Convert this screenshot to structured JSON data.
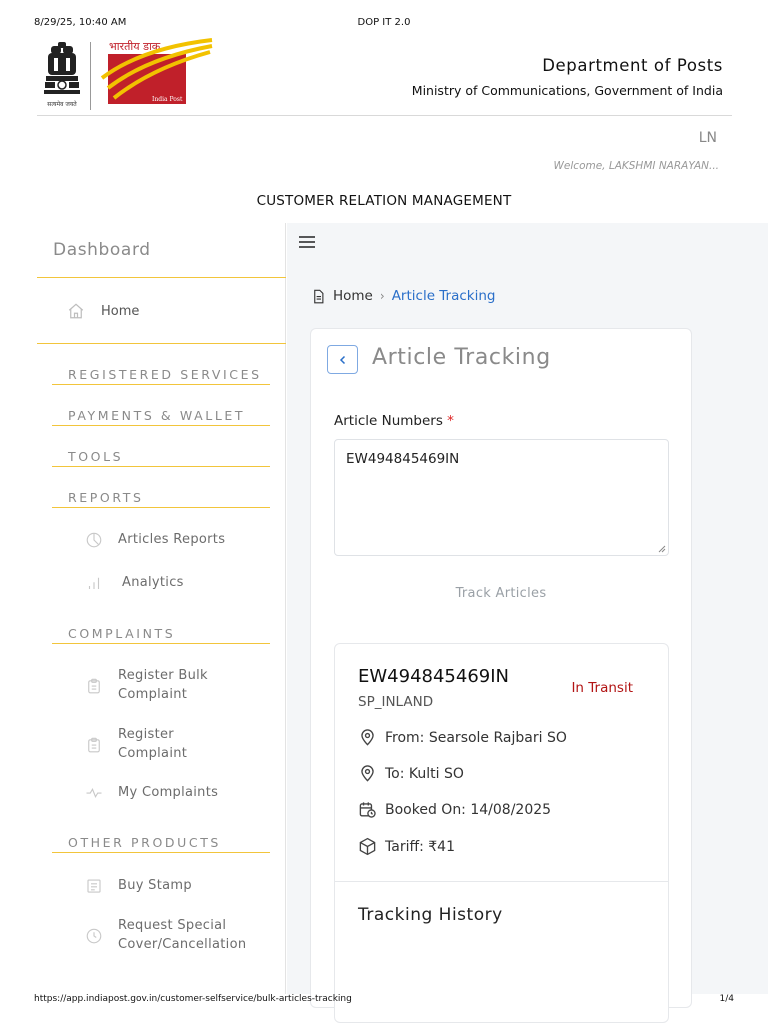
{
  "print": {
    "timestamp": "8/29/25, 10:40 AM",
    "page_title": "DOP IT 2.0",
    "url": "https://app.indiapost.gov.in/customer-selfservice/bulk-articles-tracking",
    "page_number": "1/4"
  },
  "header": {
    "emblem_text": "सत्यमेव जयते",
    "logo_hindi": "भारतीय डाक",
    "logo_english": "India Post",
    "dept_name": "Department of Posts",
    "ministry": "Ministry of Communications, Government of India"
  },
  "user": {
    "initials": "LN",
    "welcome": "Welcome, LAKSHMI NARAYAN..."
  },
  "page_heading": "CUSTOMER RELATION MANAGEMENT",
  "sidebar": {
    "dashboard": "Dashboard",
    "home": "Home",
    "sections": {
      "registered": "REGISTERED SERVICES",
      "payments": "PAYMENTS & WALLET",
      "tools": "TOOLS",
      "reports": "REPORTS",
      "complaints": "COMPLAINTS",
      "other": "OTHER PRODUCTS"
    },
    "items": {
      "articles_reports": "Articles Reports",
      "analytics": "Analytics",
      "register_bulk_1": "Register Bulk",
      "register_bulk_2": "Complaint",
      "register_1": "Register",
      "register_2": "Complaint",
      "my_complaints": "My Complaints",
      "buy_stamp": "Buy Stamp",
      "request_special_1": "Request Special",
      "request_special_2": "Cover/Cancellation"
    }
  },
  "breadcrumb": {
    "home": "Home",
    "current": "Article Tracking"
  },
  "tracking": {
    "title": "Article Tracking",
    "field_label": "Article Numbers",
    "required_mark": "*",
    "input_value": "EW494845469IN",
    "button_label": "Track Articles",
    "result": {
      "article_number": "EW494845469IN",
      "status": "In Transit",
      "type": "SP_INLAND",
      "from": "From: Searsole Rajbari SO",
      "to": "To: Kulti SO",
      "booked_on": "Booked On: 14/08/2025",
      "tariff": "Tariff: ₹41",
      "history_title": "Tracking History"
    }
  },
  "colors": {
    "accent_blue": "#2a6fc9",
    "status_red": "#b21414",
    "sidebar_line": "#f2c53b",
    "logo_red": "#c0202a",
    "logo_yellow": "#f2c200"
  }
}
